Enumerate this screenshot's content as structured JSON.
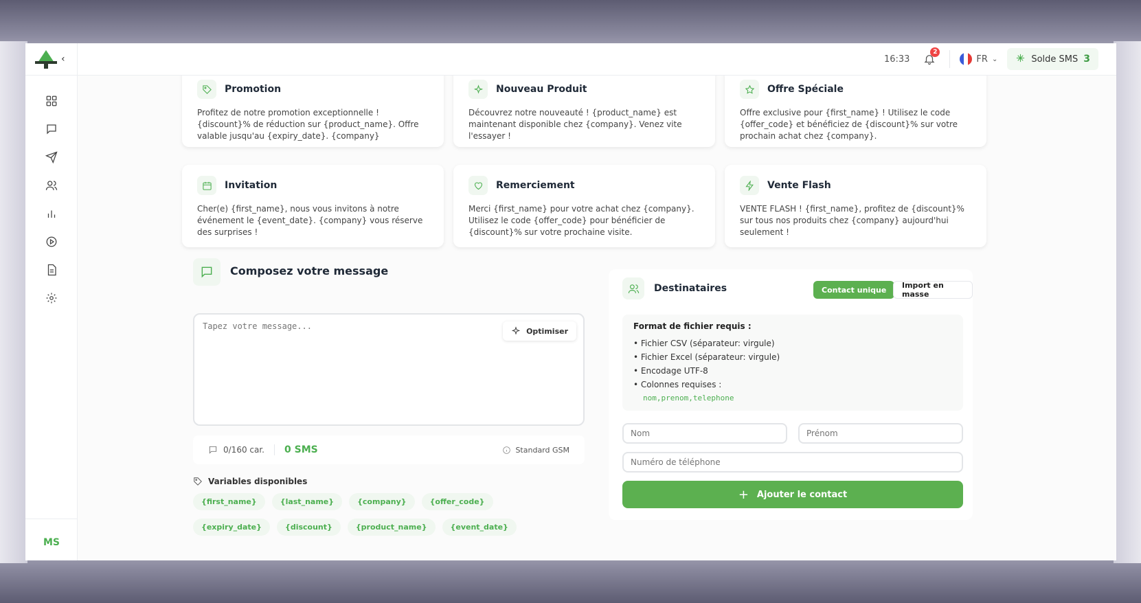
{
  "topbar": {
    "time": "16:33",
    "notification_count": "2",
    "language": "FR",
    "sms_balance_label": "Solde SMS",
    "sms_balance_value": "3"
  },
  "sidebar": {
    "avatar_initials": "MS",
    "items": [
      {
        "icon": "dashboard-grid-icon"
      },
      {
        "icon": "chat-icon"
      },
      {
        "icon": "send-icon"
      },
      {
        "icon": "users-icon"
      },
      {
        "icon": "bar-chart-icon"
      },
      {
        "icon": "play-circle-icon"
      },
      {
        "icon": "document-icon"
      },
      {
        "icon": "settings-gear-icon"
      }
    ]
  },
  "templates": [
    {
      "title": "Promotion",
      "icon": "tag-icon",
      "text": "Profitez de notre promotion exceptionnelle ! {discount}% de réduction sur {product_name}. Offre valable jusqu'au {expiry_date}. {company}"
    },
    {
      "title": "Nouveau Produit",
      "icon": "sparkles-icon",
      "text": "Découvrez notre nouveauté ! {product_name} est maintenant disponible chez {company}. Venez vite l'essayer !"
    },
    {
      "title": "Offre Spéciale",
      "icon": "star-icon",
      "text": "Offre exclusive pour {first_name} ! Utilisez le code {offer_code} et bénéficiez de {discount}% sur votre prochain achat chez {company}."
    },
    {
      "title": "Invitation",
      "icon": "calendar-icon",
      "text": "Cher(e) {first_name}, nous vous invitons à notre événement le {event_date}. {company} vous réserve des surprises !"
    },
    {
      "title": "Remerciement",
      "icon": "heart-icon",
      "text": "Merci {first_name} pour votre achat chez {company}. Utilisez le code {offer_code} pour bénéficier de {discount}% sur votre prochaine visite."
    },
    {
      "title": "Vente Flash",
      "icon": "lightning-icon",
      "text": "VENTE FLASH ! {first_name}, profitez de {discount}% sur tous nos produits chez {company} aujourd'hui seulement !"
    }
  ],
  "compose": {
    "title": "Composez votre message",
    "placeholder": "Tapez votre message...",
    "optimize_label": "Optimiser",
    "char_count": "0/160 car.",
    "sms_count": "0 SMS",
    "encoding": "Standard GSM",
    "variables_label": "Variables disponibles",
    "variables": [
      "{first_name}",
      "{last_name}",
      "{company}",
      "{offer_code}",
      "{expiry_date}",
      "{discount}",
      "{product_name}",
      "{event_date}"
    ]
  },
  "recipients": {
    "title": "Destinataires",
    "tab_single": "Contact unique",
    "tab_bulk": "Import en masse",
    "format_title": "Format de fichier requis :",
    "format_items": [
      "• Fichier CSV (séparateur: virgule)",
      "• Fichier Excel (séparateur: virgule)",
      "• Encodage UTF-8",
      "• Colonnes requises :"
    ],
    "format_columns": "nom,prenom,telephone",
    "last_name_placeholder": "Nom",
    "first_name_placeholder": "Prénom",
    "phone_placeholder": "Numéro de téléphone",
    "add_button": "Ajouter le contact"
  },
  "colors": {
    "accent": "#5cb050",
    "accent_light": "#f0f7f0",
    "badge": "#ef4444"
  }
}
